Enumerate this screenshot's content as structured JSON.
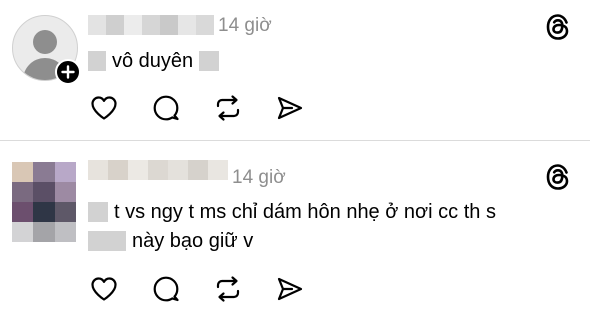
{
  "posts": [
    {
      "author_avatar": "default-profile-icon",
      "author_name_redacted": true,
      "timestamp": "14 giờ",
      "text_lines": [
        "vô duyên"
      ],
      "actions": [
        "heart-icon",
        "comment-icon",
        "repost-icon",
        "share-icon"
      ],
      "platform_icon": "threads-icon"
    },
    {
      "author_avatar": "pixelated-photo",
      "author_name_redacted": true,
      "timestamp": "14 giờ",
      "text_lines": [
        "t vs ngy t ms chỉ dám hôn nhẹ ở nơi cc th s",
        "này bạo giữ v"
      ],
      "actions": [
        "heart-icon",
        "comment-icon",
        "repost-icon",
        "share-icon"
      ],
      "platform_icon": "threads-icon"
    }
  ],
  "colors": {
    "text": "#000000",
    "timestamp": "#8e8e8e",
    "divider": "#dbdbdb",
    "redaction": "#d2d2d2"
  }
}
